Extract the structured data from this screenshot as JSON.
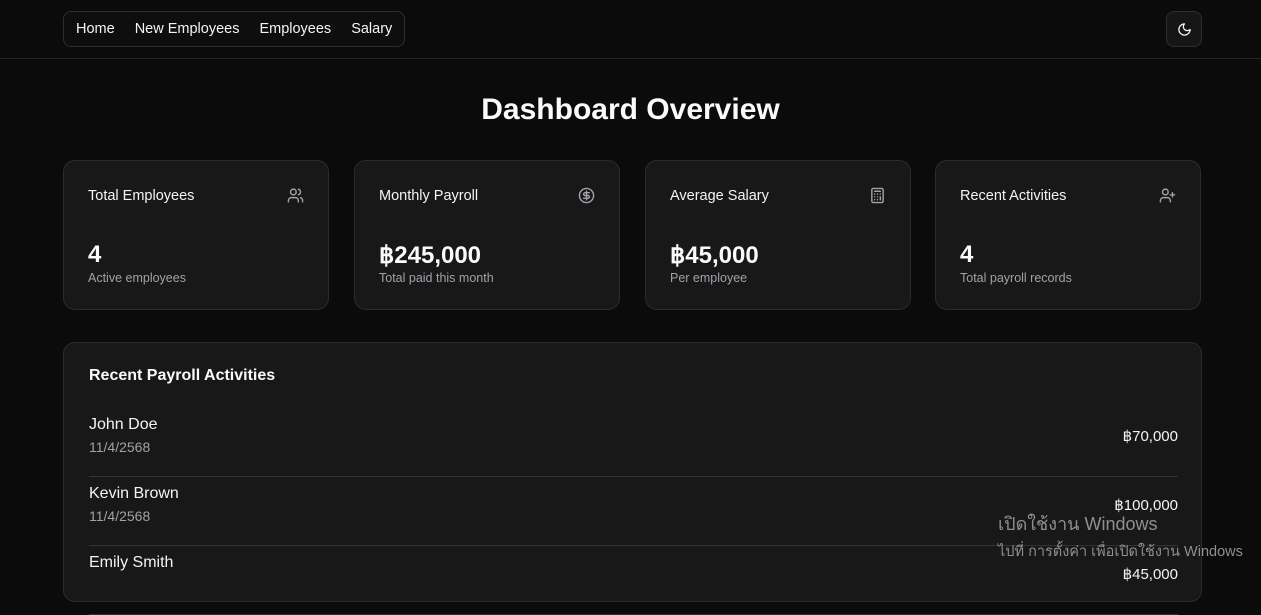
{
  "nav": {
    "items": [
      {
        "label": "Home"
      },
      {
        "label": "New Employees"
      },
      {
        "label": "Employees"
      },
      {
        "label": "Salary"
      }
    ],
    "theme_toggle_icon": "moon-icon"
  },
  "page": {
    "title": "Dashboard Overview"
  },
  "stats": [
    {
      "title": "Total Employees",
      "value": "4",
      "subtitle": "Active employees",
      "icon": "users-icon"
    },
    {
      "title": "Monthly Payroll",
      "value": "฿245,000",
      "subtitle": "Total paid this month",
      "icon": "dollar-circle-icon"
    },
    {
      "title": "Average Salary",
      "value": "฿45,000",
      "subtitle": "Per employee",
      "icon": "calculator-icon"
    },
    {
      "title": "Recent Activities",
      "value": "4",
      "subtitle": "Total payroll records",
      "icon": "user-plus-icon"
    }
  ],
  "recent": {
    "title": "Recent Payroll Activities",
    "rows": [
      {
        "name": "John Doe",
        "date": "11/4/2568",
        "amount": "฿70,000"
      },
      {
        "name": "Kevin Brown",
        "date": "11/4/2568",
        "amount": "฿100,000"
      },
      {
        "name": "Emily Smith",
        "date": "",
        "amount": "฿45,000"
      }
    ]
  },
  "watermark": {
    "line1": "เปิดใช้งาน Windows",
    "line2": "ไปที่ การตั้งค่า เพื่อเปิดใช้งาน Windows"
  }
}
